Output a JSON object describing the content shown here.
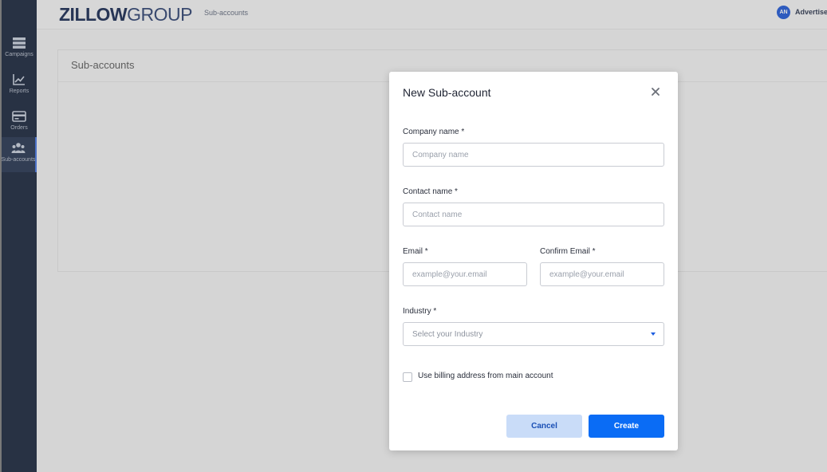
{
  "app": {
    "logo_bold": "ZILLOW",
    "logo_light": "GROUP",
    "breadcrumb": "Sub-accounts",
    "avatar_initials": "AN",
    "account_label": "Advertiser"
  },
  "sidebar": {
    "items": [
      {
        "label": "Campaigns",
        "icon": "list-icon"
      },
      {
        "label": "Reports",
        "icon": "chart-icon"
      },
      {
        "label": "Orders",
        "icon": "card-icon"
      },
      {
        "label": "Sub-accounts",
        "icon": "users-icon",
        "active": true
      }
    ]
  },
  "page": {
    "title": "Sub-accounts"
  },
  "modal": {
    "title": "New Sub-account",
    "company": {
      "label": "Company name *",
      "placeholder": "Company name",
      "value": ""
    },
    "contact": {
      "label": "Contact name *",
      "placeholder": "Contact name",
      "value": ""
    },
    "email": {
      "label": "Email *",
      "placeholder": "example@your.email",
      "value": ""
    },
    "confirm_email": {
      "label": "Confirm Email *",
      "placeholder": "example@your.email",
      "value": ""
    },
    "industry": {
      "label": "Industry *",
      "placeholder": "Select your Industry"
    },
    "billing_checkbox": {
      "label": "Use billing address from main account",
      "checked": false
    },
    "cancel_label": "Cancel",
    "create_label": "Create"
  },
  "colors": {
    "sidebar_bg": "#0e1b33",
    "primary": "#0a6cf5",
    "cancel_bg": "#c9dcf8"
  }
}
